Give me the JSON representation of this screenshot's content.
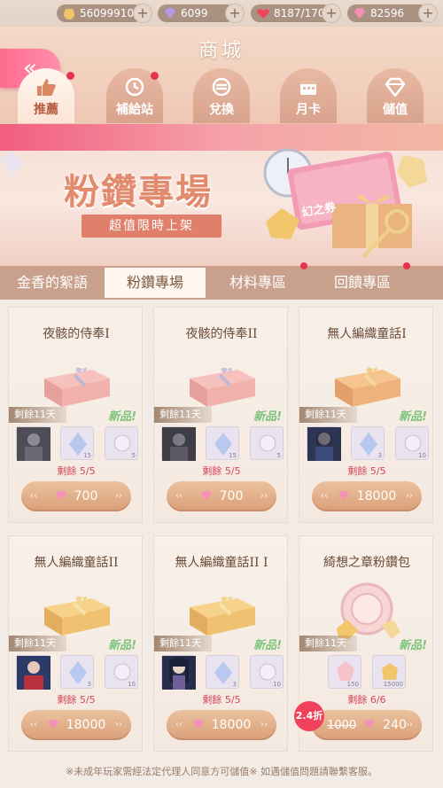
{
  "currency": {
    "gold": "56099910",
    "purple_gem": "6099",
    "stamina": "8187/170",
    "pink_gem": "82596"
  },
  "header": {
    "title": "商城",
    "tabs": [
      {
        "label": "推薦",
        "icon": "thumbs-up-icon"
      },
      {
        "label": "補給站",
        "icon": "clock-icon"
      },
      {
        "label": "兌換",
        "icon": "exchange-icon"
      },
      {
        "label": "月卡",
        "icon": "calendar-icon"
      },
      {
        "label": "儲值",
        "icon": "diamond-icon"
      }
    ]
  },
  "banner": {
    "title": "粉鑽專場",
    "subtitle": "超值限時上架",
    "card_text": "幻之券"
  },
  "subtabs": [
    "金香的絮語",
    "粉鑽專場",
    "材料專區",
    "回饋專區"
  ],
  "cards": [
    {
      "name": "夜骸的侍奉I",
      "days": "剩餘11天",
      "new": "新品!",
      "stock": "剩餘 5/5",
      "price": "700",
      "items": [
        "",
        "15",
        "5"
      ]
    },
    {
      "name": "夜骸的侍奉II",
      "days": "剩餘11天",
      "new": "新品!",
      "stock": "剩餘 5/5",
      "price": "700",
      "items": [
        "",
        "15",
        "5"
      ]
    },
    {
      "name": "無人編織童話I",
      "days": "剩餘11天",
      "new": "新品!",
      "stock": "剩餘 5/5",
      "price": "18000",
      "items": [
        "",
        "3",
        "10"
      ]
    },
    {
      "name": "無人編織童話II",
      "days": "剩餘11天",
      "new": "新品!",
      "stock": "剩餘 5/5",
      "price": "18000",
      "items": [
        "",
        "3",
        "10"
      ]
    },
    {
      "name": "無人編織童話II I",
      "days": "剩餘11天",
      "new": "新品!",
      "stock": "剩餘 5/5",
      "price": "18000",
      "items": [
        "",
        "3",
        "10"
      ]
    },
    {
      "name": "綺想之章粉鑽包",
      "days": "剩餘11天",
      "new": "新品!",
      "stock": "剩餘 6/6",
      "price": "240",
      "original_price": "1000",
      "discount": "2.4折",
      "items": [
        "150",
        "15000"
      ]
    }
  ],
  "footer": "※未成年玩家需經法定代理人同意方可儲值※ 如遇儲值問題請聯繫客服。",
  "colors": {
    "accent_pink": "#ff6b8f",
    "price_button": "#d99f78",
    "new_tag": "#7cc47b",
    "stock_red": "#d7445a"
  }
}
